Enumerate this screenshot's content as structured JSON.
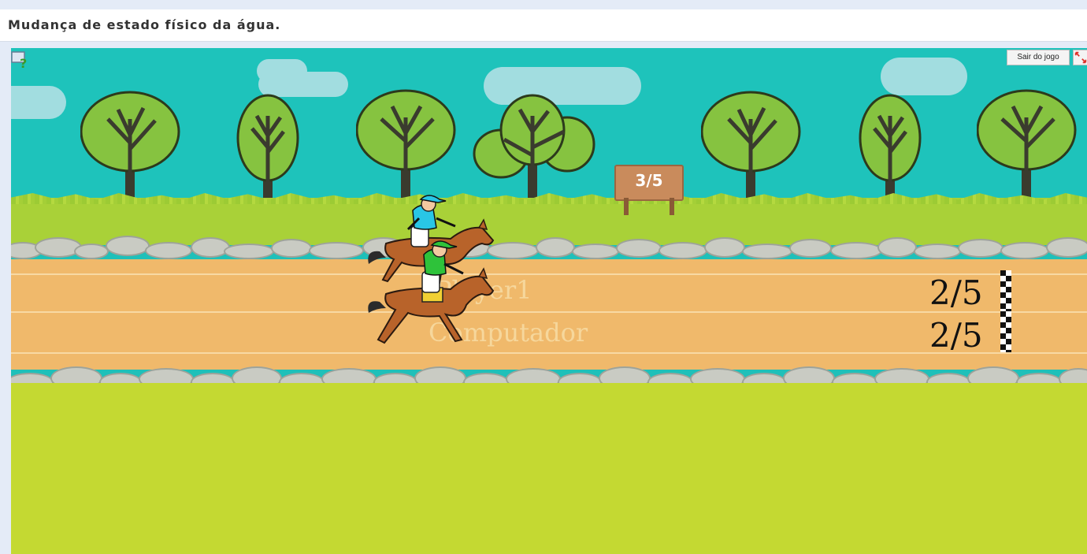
{
  "page": {
    "title": "Mudança de estado físico da água."
  },
  "game": {
    "round_sign": "3/5",
    "exit_button_label": "Sair do jogo",
    "players": [
      {
        "name": "Player1",
        "score": "2/5",
        "jockey_color": "#29c6e6"
      },
      {
        "name": "Computador",
        "score": "2/5",
        "jockey_color": "#2ec23a"
      }
    ],
    "icons": {
      "help": "help-icon",
      "fullscreen": "fullscreen-icon",
      "finish_flag": "checkered-flag-icon"
    },
    "colors": {
      "sky": "#1ec3bb",
      "track": "#f0b96b",
      "grass": "#c4d932"
    }
  }
}
